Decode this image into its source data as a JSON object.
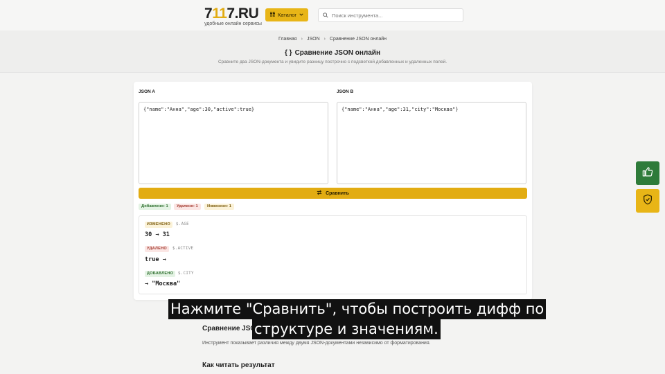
{
  "header": {
    "logo_prefix": "7",
    "logo_accent": "11",
    "logo_suffix": "7.RU",
    "logo_tagline": "удобные онлайн сервисы",
    "catalog_label": "Каталог",
    "search_placeholder": "Поиск инструмента..."
  },
  "breadcrumb": [
    "Главная",
    "JSON",
    "Сравнение JSON онлайн"
  ],
  "page": {
    "title_icon": "{ }",
    "title": "Сравнение JSON онлайн",
    "subtitle": "Сравните два JSON-документа и увидите разницу построчно с подсветкой добавленных и удаленных полей."
  },
  "editor": {
    "label_a": "JSON A",
    "label_b": "JSON B",
    "value_a": "{\"name\":\"Анна\",\"age\":30,\"active\":true}",
    "value_b": "{\"name\":\"Анна\",\"age\":31,\"city\":\"Москва\"}",
    "compare_label": "Сравнить"
  },
  "summary": {
    "added": "Добавлено: 1",
    "removed": "Удалено: 1",
    "changed": "Изменено: 1"
  },
  "diff": [
    {
      "type": "ИЗМЕНЕНО",
      "path": "$.AGE",
      "value": "30 → 31"
    },
    {
      "type": "УДАЛЕНО",
      "path": "$.ACTIVE",
      "value": "true →"
    },
    {
      "type": "ДОБАВЛЕНО",
      "path": "$.CITY",
      "value": "→ \"Москва\""
    }
  ],
  "caption": {
    "line1": "Нажмите \"Сравнить\", чтобы построить дифф по",
    "line2": "структуре и значениям."
  },
  "content": {
    "section1_title": "Сравнение JSO",
    "section1_text": "Инструмент показывает различия между двумя JSON-документами независимо от форматирования.",
    "section2_title": "Как читать результат"
  },
  "colors": {
    "accent": "#e2ac12",
    "like_button": "#2e7b3a",
    "shield_button": "#e8b517"
  },
  "icons": {
    "catalog": "grid-icon",
    "search": "search-icon",
    "compare": "swap-icon",
    "like": "thumbs-up-icon",
    "shield": "shield-check-icon"
  }
}
